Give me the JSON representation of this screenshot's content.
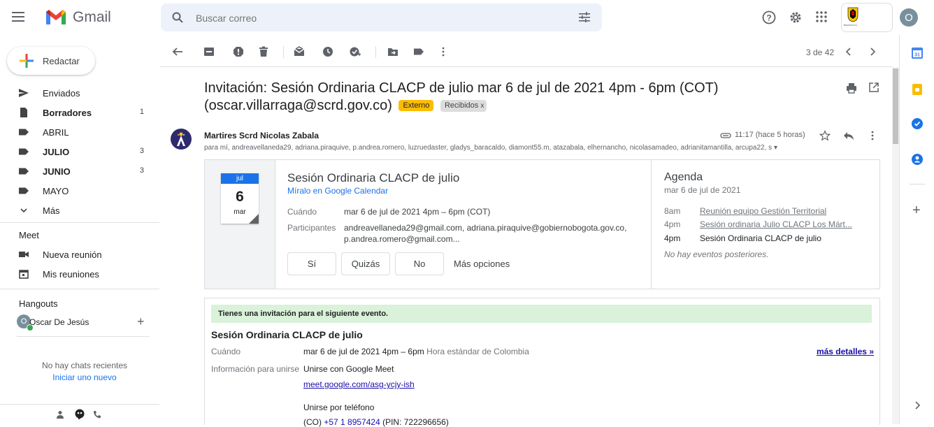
{
  "app": {
    "name": "Gmail"
  },
  "search": {
    "placeholder": "Buscar correo"
  },
  "account": {
    "avatar_letter": "O",
    "org_logo_text": "BOGOTÁ D.C."
  },
  "compose": {
    "label": "Redactar"
  },
  "sidebar": {
    "items": [
      {
        "label": "Enviados",
        "count": "",
        "bold": false
      },
      {
        "label": "Borradores",
        "count": "1",
        "bold": true
      },
      {
        "label": "ABRIL",
        "count": "",
        "bold": false
      },
      {
        "label": "JULIO",
        "count": "3",
        "bold": true
      },
      {
        "label": "JUNIO",
        "count": "3",
        "bold": true
      },
      {
        "label": "MAYO",
        "count": "",
        "bold": false
      },
      {
        "label": "Más",
        "count": "",
        "bold": false
      }
    ],
    "meet": {
      "title": "Meet",
      "new_meeting": "Nueva reunión",
      "my_meetings": "Mis reuniones"
    },
    "hangouts": {
      "title": "Hangouts",
      "user": "Oscar De Jesús",
      "user_initial": "O",
      "no_chats": "No hay chats recientes",
      "start_new": "Iniciar uno nuevo"
    }
  },
  "toolbar": {
    "pagination": "3 de 42"
  },
  "email": {
    "subject_line1": "Invitación: Sesión Ordinaria CLACP de julio mar 6 de jul de 2021 4pm - 6pm (COT)",
    "subject_line2": "(oscar.villarraga@scrd.gov.co)",
    "badge_external": "Externo",
    "badge_inbox": "Recibidos",
    "sender": "Martires Scrd Nicolas Zabala",
    "recipients": "para mí, andreavellaneda29, adriana.piraquive, p.andrea.romero, luzruedaster, gladys_baracaldo, diamont55.m, atazabala, elhernancho, nicolasamadeo, adrianitamantilla, arcupa22, s",
    "time": "11:17 (hace 5 horas)"
  },
  "invite_card": {
    "cal_month": "jul",
    "cal_day": "6",
    "cal_weekday": "mar",
    "title": "Sesión Ordinaria CLACP de julio",
    "view_link": "Míralo en Google Calendar",
    "when_label": "Cuándo",
    "when_value": "mar 6 de jul de 2021 4pm – 6pm (COT)",
    "participants_label": "Participantes",
    "participants_value_1": "andreavellaneda29@gmail.com, adriana.piraquive@gobiernobogota.gov.co,",
    "participants_value_2": "p.andrea.romero@gmail.com...",
    "rsvp_yes": "Sí",
    "rsvp_maybe": "Quizás",
    "rsvp_no": "No",
    "more_options": "Más opciones",
    "agenda": {
      "title": "Agenda",
      "date": "mar 6 de jul de 2021",
      "events": [
        {
          "time": "8am",
          "title": "Reunión equipo Gestión Territorial",
          "link": true
        },
        {
          "time": "4pm",
          "title": "Sesión ordinaria Julio CLACP Los Márt...",
          "link": true
        },
        {
          "time": "4pm",
          "title": "Sesión Ordinaria CLACP de julio",
          "link": false
        }
      ],
      "no_more": "No hay eventos posteriores."
    }
  },
  "invitation_body": {
    "banner": "Tienes una invitación para el siguiente evento.",
    "event_title": "Sesión Ordinaria CLACP de julio",
    "when_label": "Cuándo",
    "when_value": "mar 6 de jul de 2021 4pm – 6pm",
    "when_tz": "Hora estándar de Colombia",
    "more_details": "más detalles »",
    "join_label": "Información para unirse",
    "join_meet": "Unirse con Google Meet",
    "meet_link": "meet.google.com/asg-ycjy-ish",
    "join_phone": "Unirse por teléfono",
    "phone_prefix": "(CO) ",
    "phone_number": "+57 1 8957424",
    "phone_pin": " (PIN: 722296656)"
  },
  "colors": {
    "accent": "#1a73e8",
    "badge_external": "#fbbc04",
    "banner_bg": "#d9f2d9"
  }
}
